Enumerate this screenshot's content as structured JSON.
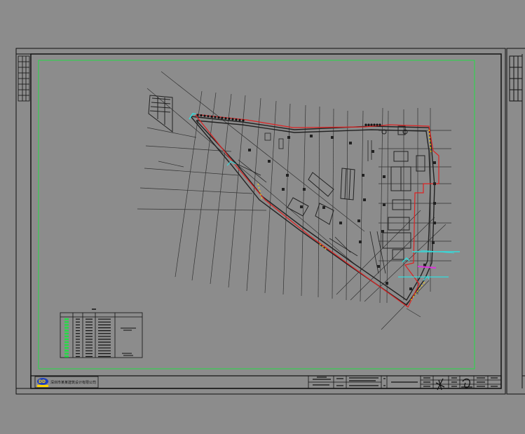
{
  "drawing": {
    "background": "#8c8c8c",
    "colors": {
      "sheet_border": "#111111",
      "inner_frame": "#22dd44",
      "linework": "#222222",
      "outline": "#dd2222",
      "accent_cyan": "#33dddd",
      "accent_magenta": "#dd33dd",
      "accent_yellow": "#ffd400"
    }
  },
  "title_block": {
    "company_logo": "logo-icon",
    "company_name": "深圳市某某建筑设计有限公司"
  }
}
